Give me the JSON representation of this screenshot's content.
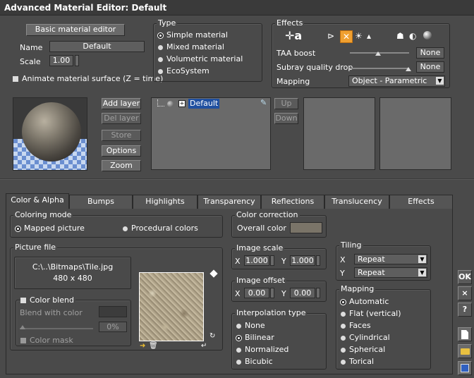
{
  "window": {
    "title": "Advanced Material Editor: Default"
  },
  "left": {
    "basic_editor_button": "Basic material editor",
    "name_label": "Name",
    "name_value": "Default",
    "scale_label": "Scale",
    "scale_value": "1.00",
    "animate_label": "Animate material surface (Z = time)"
  },
  "type": {
    "title": "Type",
    "options": [
      "Simple material",
      "Mixed material",
      "Volumetric material",
      "EcoSystem"
    ],
    "selected": "Simple material"
  },
  "effects": {
    "title": "Effects",
    "taa_label": "TAA boost",
    "taa_value": "None",
    "subray_label": "Subray quality drop",
    "subray_value": "None",
    "mapping_label": "Mapping",
    "mapping_value": "Object - Parametric"
  },
  "layers": {
    "add": "Add layer",
    "del": "Del layer",
    "store": "Store",
    "options": "Options",
    "zoom": "Zoom",
    "up": "Up",
    "down": "Down",
    "tree_item": "Default"
  },
  "tabs": [
    "Color & Alpha",
    "Bumps",
    "Highlights",
    "Transparency",
    "Reflections",
    "Translucency",
    "Effects"
  ],
  "coloring": {
    "title": "Coloring mode",
    "mapped": "Mapped picture",
    "procedural": "Procedural colors"
  },
  "picture": {
    "title": "Picture file",
    "path": "C:\\..\\Bitmaps\\Tile.jpg",
    "size": "480 x 480",
    "color_blend": "Color blend",
    "blend_with": "Blend with color",
    "percent": "0%",
    "color_mask": "Color mask"
  },
  "correction": {
    "title": "Color correction",
    "overall": "Overall color",
    "overall_color": "#7a7468"
  },
  "image_scale": {
    "title": "Image scale",
    "x_label": "X",
    "x": "1.000",
    "y_label": "Y",
    "y": "1.000"
  },
  "image_offset": {
    "title": "Image offset",
    "x_label": "X",
    "x": "0.00",
    "y_label": "Y",
    "y": "0.00"
  },
  "interpolation": {
    "title": "Interpolation type",
    "options": [
      "None",
      "Bilinear",
      "Normalized",
      "Bicubic"
    ],
    "selected": "Bilinear"
  },
  "tiling": {
    "title": "Tiling",
    "x_label": "X",
    "x": "Repeat",
    "y_label": "Y",
    "y": "Repeat"
  },
  "mapping": {
    "title": "Mapping",
    "options": [
      "Automatic",
      "Flat (vertical)",
      "Faces",
      "Cylindrical",
      "Spherical",
      "Torical"
    ],
    "selected": "Automatic"
  },
  "side": {
    "ok": "OK",
    "close": "×",
    "help": "?"
  }
}
